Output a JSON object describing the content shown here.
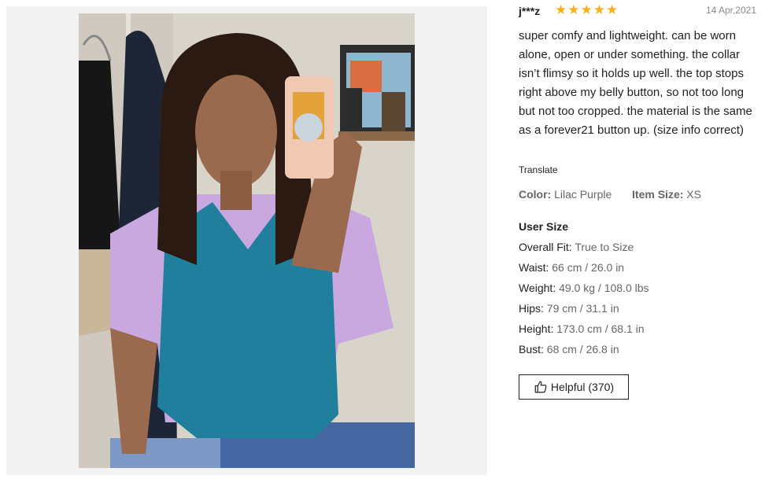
{
  "review": {
    "user_name": "j***z",
    "rating": 5,
    "rating_icon": "star-icon",
    "date": "14 Apr,2021",
    "text": "super comfy and lightweight. can be worn alone, open or under something. the collar isn’t flimsy so it holds up well. the top stops right above my belly button, so not too long but not too cropped. the material is the same as a forever21 button up. (size info correct)",
    "translate_label": "Translate",
    "color_label": "Color:",
    "color_value": "Lilac Purple",
    "item_size_label": "Item Size:",
    "item_size_value": "XS"
  },
  "user_size": {
    "title": "User Size",
    "items": [
      {
        "label": "Overall Fit:",
        "value": "True to Size"
      },
      {
        "label": "Waist:",
        "value": "66 cm / 26.0 in"
      },
      {
        "label": "Weight:",
        "value": "49.0 kg / 108.0 lbs"
      },
      {
        "label": "Hips:",
        "value": "79 cm / 31.1 in"
      },
      {
        "label": "Height:",
        "value": "173.0 cm / 68.1 in"
      },
      {
        "label": "Bust:",
        "value": "68 cm / 26.8 in"
      }
    ]
  },
  "helpful": {
    "icon": "thumbs-up-icon",
    "label": "Helpful (370)"
  },
  "colors": {
    "star": "#f6b21b",
    "text": "#222222",
    "muted": "#666666",
    "date": "#888888",
    "panel_bg": "#f3f3f3"
  }
}
